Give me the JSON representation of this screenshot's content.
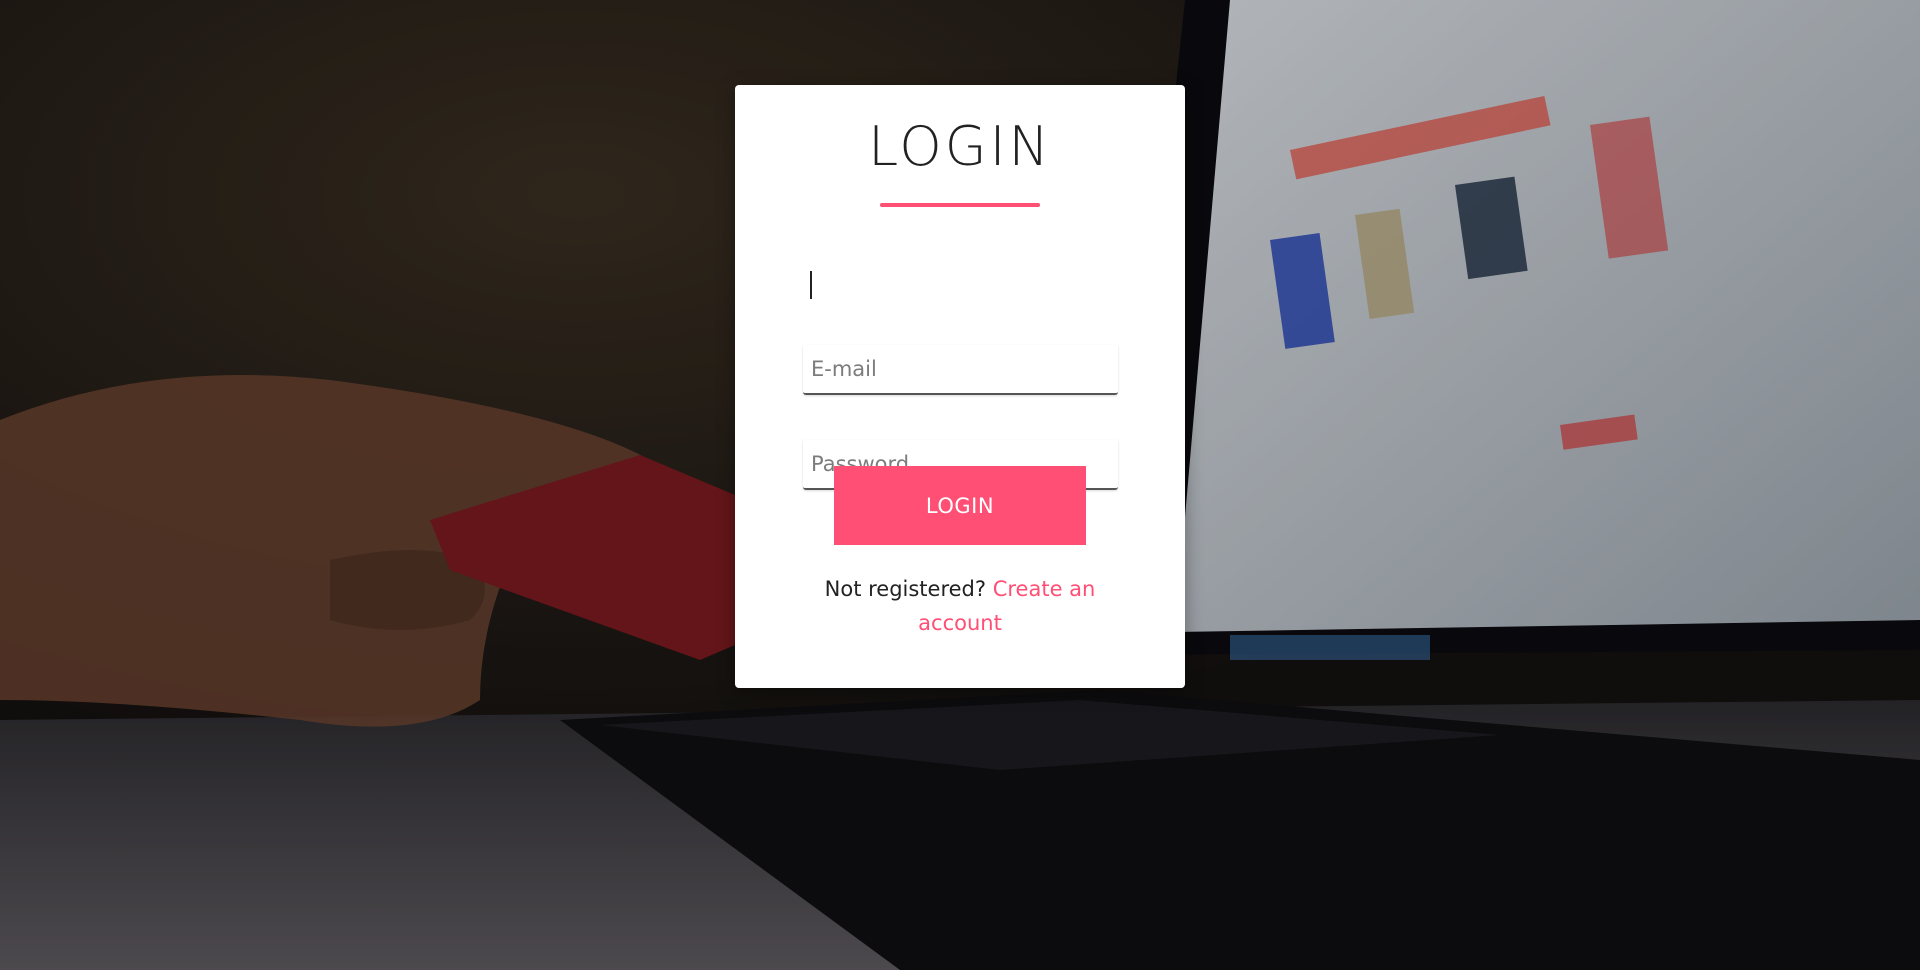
{
  "login_card": {
    "title": "LOGIN",
    "email_placeholder": "E-mail",
    "password_placeholder": "Password",
    "login_button_label": "LOGIN",
    "register_prompt": "Not registered?",
    "register_link_label": "Create an account"
  },
  "colors": {
    "accent": "#ff4f75",
    "card_background": "#ffffff",
    "title_text": "#222222"
  }
}
